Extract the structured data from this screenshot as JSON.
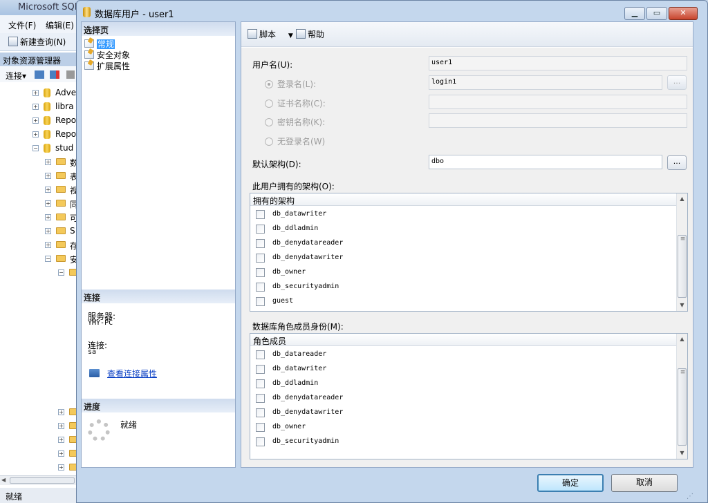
{
  "ssms": {
    "title": "Microsoft SQL",
    "menu": [
      "文件(F)",
      "编辑(E)"
    ],
    "new_query": "新建查询(N)",
    "object_explorer": "对象资源管理器",
    "connect": "连接",
    "tree": {
      "databases": [
        "Adve",
        "libra",
        "Repo",
        "Repo",
        "stud"
      ],
      "folders": [
        "数",
        "表",
        "视",
        "同",
        "可",
        "S",
        "存",
        "安"
      ]
    },
    "status": "就绪"
  },
  "dialog": {
    "title": "数据库用户 - user1",
    "select_page": {
      "header": "选择页",
      "pages": [
        "常规",
        "安全对象",
        "扩展属性"
      ],
      "selected": "常规"
    },
    "connection": {
      "header": "连接",
      "server_label": "服务器:",
      "server": "YMY-PC",
      "connection_label": "连接:",
      "connection": "sa",
      "view_link": "查看连接属性"
    },
    "progress": {
      "header": "进度",
      "status": "就绪"
    },
    "toolbar": {
      "script": "脚本",
      "help": "帮助"
    },
    "form": {
      "username_label": "用户名(U):",
      "username": "user1",
      "login_radio": "登录名(L):",
      "login": "login1",
      "cert_radio": "证书名称(C):",
      "key_radio": "密钥名称(K):",
      "nologin_radio": "无登录名(W)",
      "default_schema_label": "默认架构(D):",
      "default_schema": "dbo",
      "ellipsis": "...",
      "owned_schemas_label": "此用户拥有的架构(O):",
      "owned_schemas_header": "拥有的架构",
      "owned_schemas": [
        "db_datawriter",
        "db_ddladmin",
        "db_denydatareader",
        "db_denydatawriter",
        "db_owner",
        "db_securityadmin",
        "guest"
      ],
      "role_label": "数据库角色成员身份(M):",
      "role_header": "角色成员",
      "roles": [
        "db_datareader",
        "db_datawriter",
        "db_ddladmin",
        "db_denydatareader",
        "db_denydatawriter",
        "db_owner",
        "db_securityadmin"
      ]
    },
    "buttons": {
      "ok": "确定",
      "cancel": "取消"
    },
    "window_buttons": {
      "minimize": "▁",
      "maximize": "▭",
      "close": "✕"
    }
  }
}
